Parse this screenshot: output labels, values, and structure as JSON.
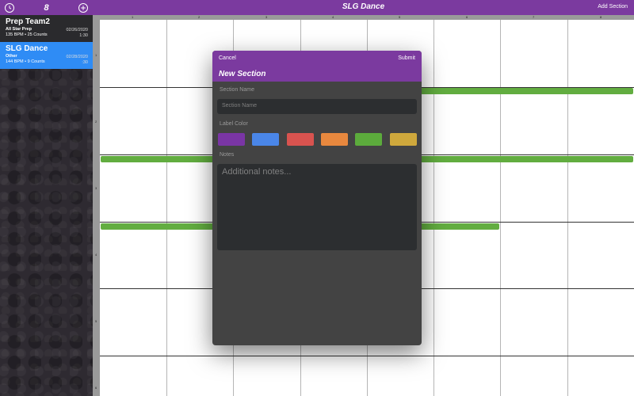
{
  "sidebar": {
    "count": "8",
    "songs": [
      {
        "title": "Prep Team2",
        "category": "All Star Prep",
        "meta": "135 BPM • 25 Counts",
        "date": "02/26/2020",
        "duration": "1:30"
      },
      {
        "title": "SLG Dance",
        "category": "Other",
        "meta": "144 BPM • 9 Counts",
        "date": "02/28/2020",
        "duration": ":30"
      }
    ]
  },
  "header": {
    "title": "SLG Dance",
    "add_section_label": "Add Section"
  },
  "ruler": {
    "columns": [
      "1",
      "2",
      "3",
      "4",
      "5",
      "6",
      "7",
      "8"
    ],
    "rows": [
      "1",
      "2",
      "3",
      "4",
      "5",
      "6"
    ]
  },
  "modal": {
    "cancel_label": "Cancel",
    "submit_label": "Submit",
    "title": "New Section",
    "section_name_label": "Section Name",
    "section_name_placeholder": "Section Name",
    "label_color_label": "Label Color",
    "colors": [
      "#7a35a5",
      "#4a86e8",
      "#d9534f",
      "#e8883e",
      "#5cab3c",
      "#cfa83c"
    ],
    "notes_label": "Notes",
    "notes_placeholder": "Additional notes..."
  },
  "colors": {
    "accent": "#7b3a9f",
    "selected": "#2f8cf5",
    "section_bar": "#62ad40"
  }
}
